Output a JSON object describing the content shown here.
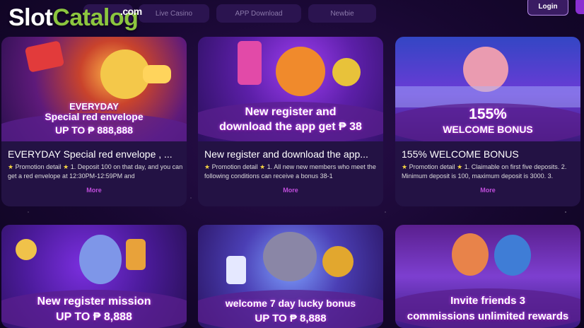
{
  "logo": {
    "slot": "Slot",
    "catalog": "Catalog",
    "com": ".com"
  },
  "nav": {
    "tabs": [
      "Live Casino",
      "APP Download",
      "Newbie"
    ],
    "login": "Login"
  },
  "cards": [
    {
      "banner_line1": "EVERYDAY",
      "banner_line2": "Special red envelope",
      "banner_amount": "UP TO ₱ 888,888",
      "title": "EVERYDAY Special red envelope , ...",
      "desc_label": "Promotion detail",
      "desc_text": "1. Deposit 100 on that day, and you can get a red envelope at 12:30PM-12:59PM and",
      "more": "More"
    },
    {
      "banner_line1": "New register and",
      "banner_line2": "download the app get ₱ 38",
      "title": "New register and download the app...",
      "desc_label": "Promotion detail",
      "desc_text": "1. All new new members who meet the following conditions can receive a bonus 38-1",
      "more": "More"
    },
    {
      "banner_line1": "155%",
      "banner_line2": "WELCOME BONUS",
      "title": "155% WELCOME BONUS",
      "desc_label": "Promotion detail",
      "desc_text": "1. Claimable on first five deposits. 2. Minimum deposit is 100, maximum deposit is 3000. 3.",
      "more": "More"
    },
    {
      "banner_line1": "New register mission",
      "banner_amount": "UP TO ₱ 8,888"
    },
    {
      "banner_line1": "welcome 7 day lucky bonus",
      "banner_amount": "UP TO ₱ 8,888"
    },
    {
      "banner_line1": "Invite friends 3",
      "banner_line2": "commissions unlimited rewards"
    }
  ]
}
